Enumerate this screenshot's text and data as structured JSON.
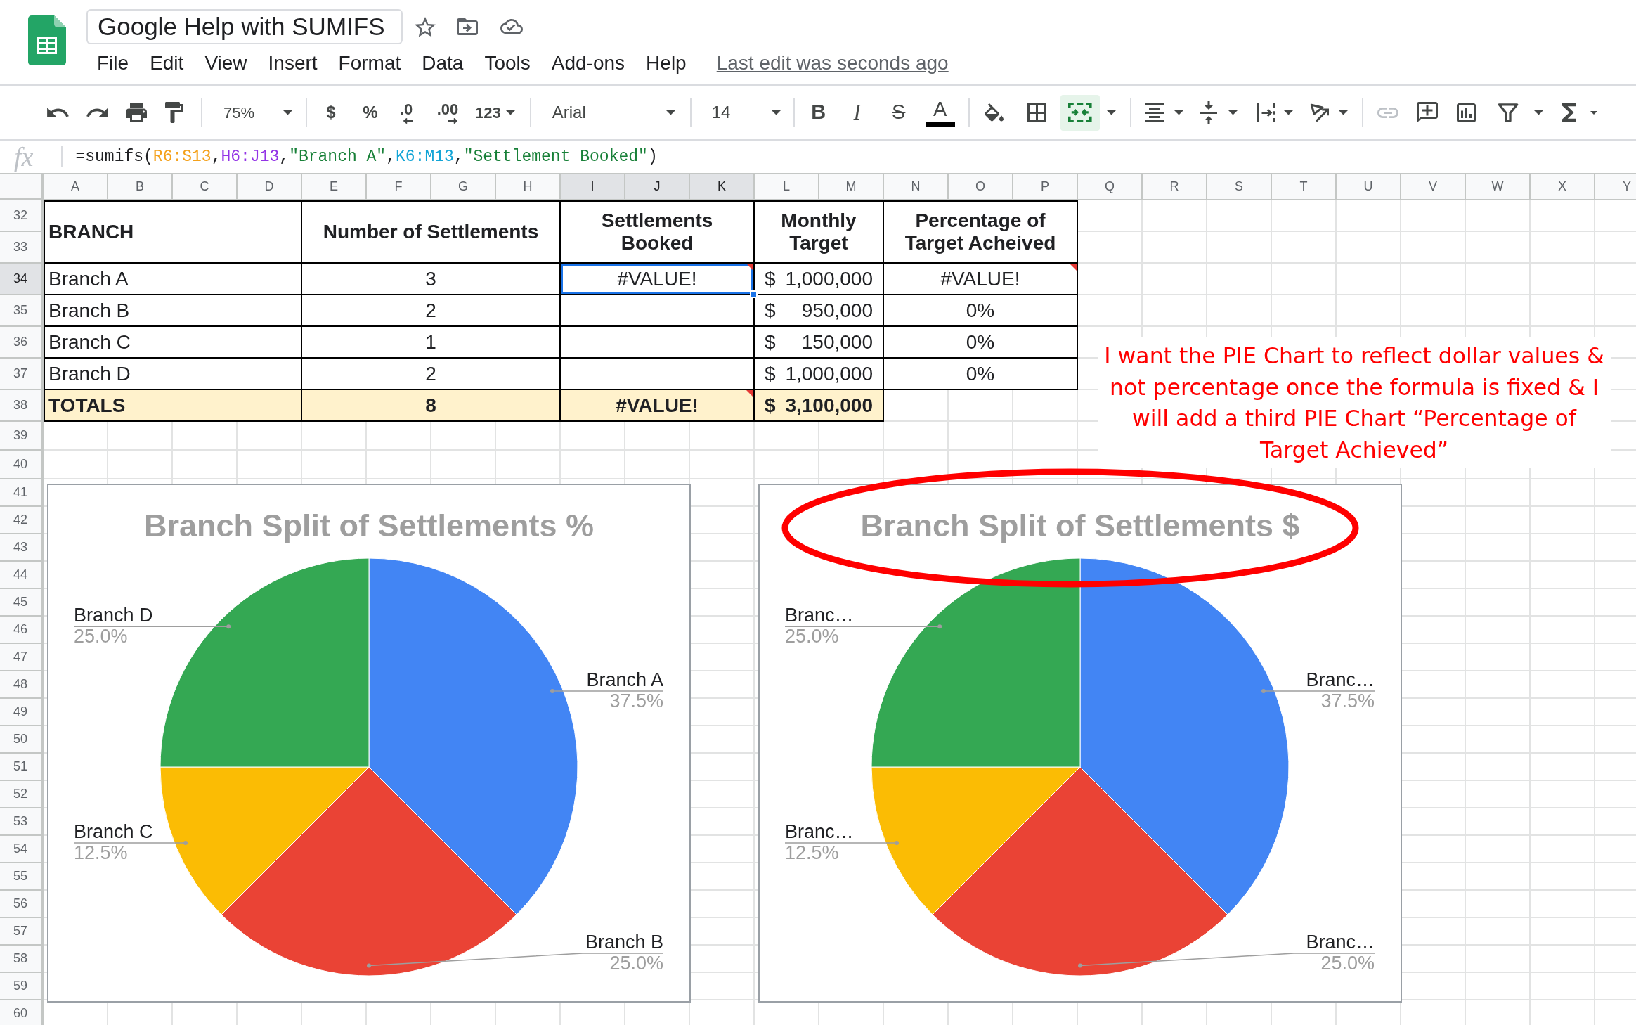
{
  "app": {
    "title": "Google Help with SUMIFS",
    "menu": [
      "File",
      "Edit",
      "View",
      "Insert",
      "Format",
      "Data",
      "Tools",
      "Add-ons",
      "Help"
    ],
    "last_edit": "Last edit was seconds ago"
  },
  "toolbar": {
    "zoom": "75%",
    "currency": "$",
    "percent": "%",
    "decimal_decrease": ".0",
    "decimal_increase": ".00",
    "number_format": "123",
    "font": "Arial",
    "font_size": "14",
    "bold": "B",
    "italic": "I",
    "strikethrough": "S",
    "text_color": "A",
    "merge_cells": {
      "on": true
    },
    "insert_link": {
      "disabled": true
    }
  },
  "formula_bar": {
    "label": "fx",
    "tokens": [
      {
        "kind": "plain",
        "text": "=sumifs("
      },
      {
        "kind": "range",
        "text": "R6:S13",
        "color": "#f4a11b"
      },
      {
        "kind": "plain",
        "text": ","
      },
      {
        "kind": "range",
        "text": "H6:J13",
        "color": "#9334e6"
      },
      {
        "kind": "plain",
        "text": ","
      },
      {
        "kind": "string",
        "text": "\"Branch A\""
      },
      {
        "kind": "plain",
        "text": ","
      },
      {
        "kind": "range",
        "text": "K6:M13",
        "color": "#12a4d6"
      },
      {
        "kind": "plain",
        "text": ","
      },
      {
        "kind": "string",
        "text": "\"Settlement Booked\""
      },
      {
        "kind": "plain",
        "text": ")"
      }
    ]
  },
  "sheet": {
    "columns": [
      {
        "label": "A",
        "selected": false
      },
      {
        "label": "B",
        "selected": false
      },
      {
        "label": "C",
        "selected": false
      },
      {
        "label": "D",
        "selected": false
      },
      {
        "label": "E",
        "selected": false
      },
      {
        "label": "F",
        "selected": false
      },
      {
        "label": "G",
        "selected": false
      },
      {
        "label": "H",
        "selected": false
      },
      {
        "label": "I",
        "selected": true
      },
      {
        "label": "J",
        "selected": true
      },
      {
        "label": "K",
        "selected": true
      },
      {
        "label": "L",
        "selected": false
      },
      {
        "label": "M",
        "selected": false
      },
      {
        "label": "N",
        "selected": false
      },
      {
        "label": "O",
        "selected": false
      },
      {
        "label": "P",
        "selected": false
      },
      {
        "label": "Q",
        "selected": false
      },
      {
        "label": "R",
        "selected": false
      },
      {
        "label": "S",
        "selected": false
      },
      {
        "label": "T",
        "selected": false
      },
      {
        "label": "U",
        "selected": false
      },
      {
        "label": "V",
        "selected": false
      },
      {
        "label": "W",
        "selected": false
      },
      {
        "label": "X",
        "selected": false
      },
      {
        "label": "Y",
        "selected": false
      }
    ],
    "rows": [
      {
        "label": "32",
        "selected": false
      },
      {
        "label": "33",
        "selected": false
      },
      {
        "label": "34",
        "selected": true
      },
      {
        "label": "35",
        "selected": false
      },
      {
        "label": "36",
        "selected": false
      },
      {
        "label": "37",
        "selected": false
      },
      {
        "label": "38",
        "selected": false
      },
      {
        "label": "39",
        "selected": false
      },
      {
        "label": "40",
        "selected": false
      },
      {
        "label": "41",
        "selected": false
      },
      {
        "label": "42",
        "selected": false
      },
      {
        "label": "43",
        "selected": false
      },
      {
        "label": "44",
        "selected": false
      },
      {
        "label": "45",
        "selected": false
      },
      {
        "label": "46",
        "selected": false
      },
      {
        "label": "47",
        "selected": false
      },
      {
        "label": "48",
        "selected": false
      },
      {
        "label": "49",
        "selected": false
      },
      {
        "label": "50",
        "selected": false
      },
      {
        "label": "51",
        "selected": false
      },
      {
        "label": "52",
        "selected": false
      },
      {
        "label": "53",
        "selected": false
      },
      {
        "label": "54",
        "selected": false
      },
      {
        "label": "55",
        "selected": false
      },
      {
        "label": "56",
        "selected": false
      },
      {
        "label": "57",
        "selected": false
      },
      {
        "label": "58",
        "selected": false
      },
      {
        "label": "59",
        "selected": false
      },
      {
        "label": "60",
        "selected": false
      }
    ],
    "table": {
      "header": [
        "BRANCH",
        "Number of Settlements",
        "Settlements Booked",
        "Monthly Target",
        "Percentage of Target Acheived"
      ],
      "rows": [
        {
          "kind": "data",
          "cells": [
            {
              "kind": "text",
              "text": "Branch A",
              "selected": false,
              "error": false
            },
            {
              "kind": "text",
              "text": "3",
              "selected": false,
              "error": false
            },
            {
              "kind": "text",
              "text": "#VALUE!",
              "selected": true,
              "error": true
            },
            {
              "kind": "money",
              "currency": "$",
              "amount": "1,000,000",
              "selected": false,
              "error": false
            },
            {
              "kind": "text",
              "text": "#VALUE!",
              "selected": false,
              "error": true
            }
          ]
        },
        {
          "kind": "data",
          "cells": [
            {
              "kind": "text",
              "text": "Branch B",
              "selected": false,
              "error": false
            },
            {
              "kind": "text",
              "text": "2",
              "selected": false,
              "error": false
            },
            {
              "kind": "text",
              "selected": false,
              "error": false
            },
            {
              "kind": "money",
              "currency": "$",
              "amount": "950,000",
              "selected": false,
              "error": false
            },
            {
              "kind": "text",
              "text": "0%",
              "selected": false,
              "error": false
            }
          ]
        },
        {
          "kind": "data",
          "cells": [
            {
              "kind": "text",
              "text": "Branch C",
              "selected": false,
              "error": false
            },
            {
              "kind": "text",
              "text": "1",
              "selected": false,
              "error": false
            },
            {
              "kind": "text",
              "selected": false,
              "error": false
            },
            {
              "kind": "money",
              "currency": "$",
              "amount": "150,000",
              "selected": false,
              "error": false
            },
            {
              "kind": "text",
              "text": "0%",
              "selected": false,
              "error": false
            }
          ]
        },
        {
          "kind": "data",
          "cells": [
            {
              "kind": "text",
              "text": "Branch D",
              "selected": false,
              "error": false
            },
            {
              "kind": "text",
              "text": "2",
              "selected": false,
              "error": false
            },
            {
              "kind": "text",
              "selected": false,
              "error": false
            },
            {
              "kind": "money",
              "currency": "$",
              "amount": "1,000,000",
              "selected": false,
              "error": false
            },
            {
              "kind": "text",
              "text": "0%",
              "selected": false,
              "error": false
            }
          ]
        },
        {
          "kind": "totals",
          "cells": [
            {
              "kind": "text",
              "text": "TOTALS",
              "selected": false,
              "error": false
            },
            {
              "kind": "text",
              "text": "8",
              "selected": false,
              "error": false
            },
            {
              "kind": "text",
              "text": "#VALUE!",
              "selected": false,
              "error": true
            },
            {
              "kind": "money",
              "currency": "$",
              "amount": "3,100,000",
              "selected": false,
              "error": false
            }
          ]
        }
      ]
    },
    "note": "I want the PIE Chart to reflect dollar values & not percentage once the formula is fixed & I will add a third PIE Chart “Percentage of Target Achieved”",
    "charts": [
      {
        "chart_data": {
          "type": "pie",
          "title": "Branch Split of Settlements %",
          "categories": [
            "Branch A",
            "Branch B",
            "Branch C",
            "Branch D"
          ],
          "values": [
            37.5,
            25,
            12.5,
            25
          ],
          "colors": [
            "#4285f4",
            "#ea4335",
            "#fbbc04",
            "#34a853"
          ],
          "value_labels": [
            "37.5%",
            "25.0%",
            "12.5%",
            "25.0%"
          ]
        }
      },
      {
        "chart_data": {
          "type": "pie",
          "title": "Branch Split of Settlements $",
          "categories": [
            "Branc…",
            "Branc…",
            "Branc…",
            "Branc…"
          ],
          "values": [
            37.5,
            25,
            12.5,
            25
          ],
          "colors": [
            "#4285f4",
            "#ea4335",
            "#fbbc04",
            "#34a853"
          ],
          "value_labels": [
            "37.5%",
            "25.0%",
            "12.5%",
            "25.0%"
          ]
        }
      }
    ]
  }
}
